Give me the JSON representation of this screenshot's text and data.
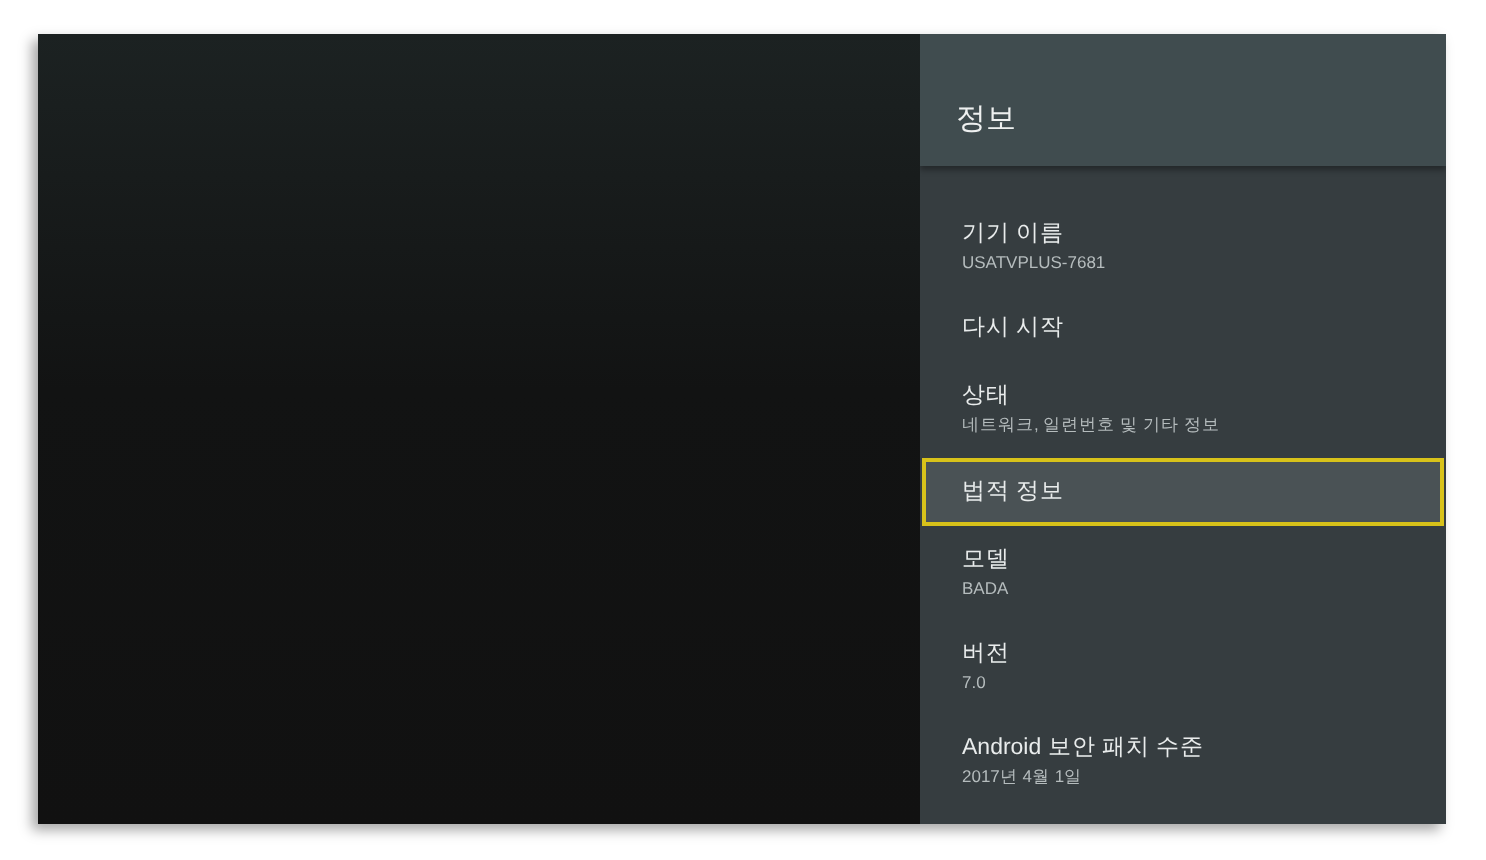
{
  "panel": {
    "title": "정보",
    "items": [
      {
        "title": "기기 이름",
        "subtitle": "USATVPLUS-7681",
        "selected": false
      },
      {
        "title": "다시 시작",
        "selected": false
      },
      {
        "title": "상태",
        "subtitle": "네트워크, 일련번호 및 기타 정보",
        "selected": false
      },
      {
        "title": "법적 정보",
        "selected": true
      },
      {
        "title": "모델",
        "subtitle": "BADA",
        "selected": false
      },
      {
        "title": "버전",
        "subtitle": "7.0",
        "selected": false
      },
      {
        "title": "Android 보안 패치 수준",
        "subtitle": "2017년 4월 1일",
        "selected": false
      }
    ]
  }
}
